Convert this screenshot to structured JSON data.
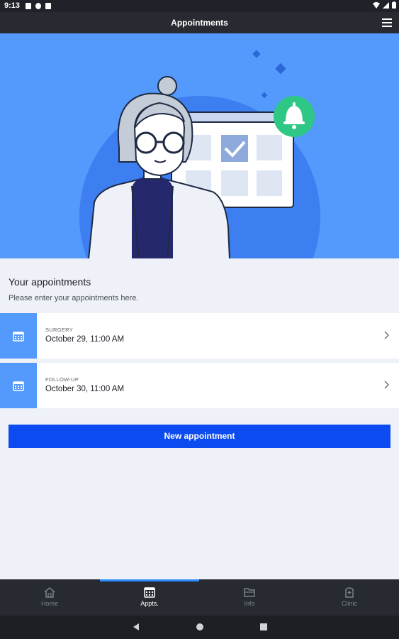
{
  "status_bar": {
    "time": "9:13"
  },
  "app_bar": {
    "title": "Appointments"
  },
  "section": {
    "title": "Your appointments",
    "subtitle": "Please enter your appointments here."
  },
  "appointments": [
    {
      "type": "SURGERY",
      "datetime": "October 29, 11:00 AM"
    },
    {
      "type": "FOLLOW-UP",
      "datetime": "October 30, 11:00 AM"
    }
  ],
  "new_button": {
    "label": "New appointment"
  },
  "bottom_nav": {
    "items": [
      {
        "label": "Home",
        "icon": "home-icon"
      },
      {
        "label": "Appts.",
        "icon": "calendar-icon"
      },
      {
        "label": "Info",
        "icon": "folder-icon"
      },
      {
        "label": "Clinic",
        "icon": "clinic-icon"
      }
    ],
    "active": 1
  },
  "colors": {
    "hero_bg": "#5499fc",
    "accent_blue": "#0c4bef",
    "bell_green": "#2ec785",
    "nav_bg": "#272b31"
  }
}
